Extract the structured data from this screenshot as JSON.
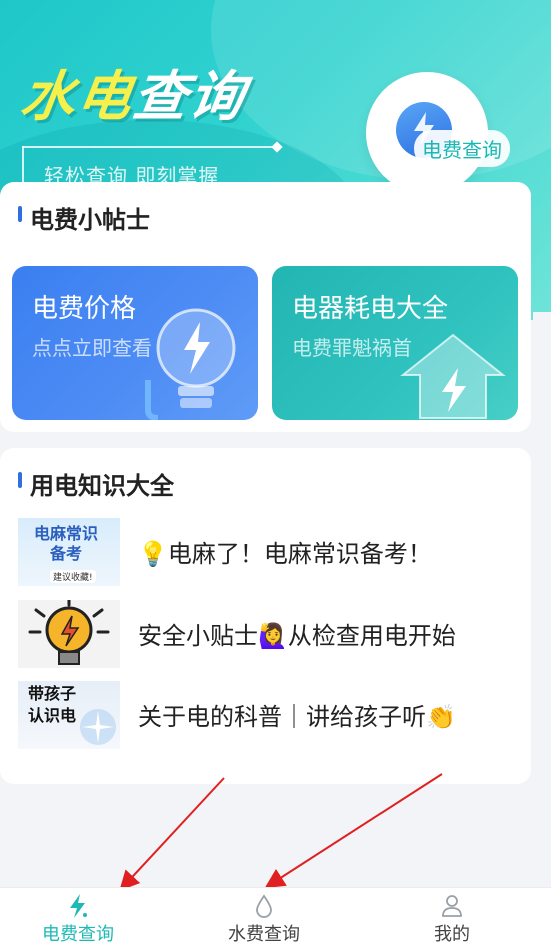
{
  "banner": {
    "title_part1": "水电",
    "title_part2": "查询",
    "slogan": "轻松查询 即刻掌握",
    "badge_label": "电费查询"
  },
  "tips_section": {
    "title": "电费小帖士",
    "tiles": [
      {
        "title": "电费价格",
        "subtitle": "点点立即查看"
      },
      {
        "title": "电器耗电大全",
        "subtitle": "电费罪魁祸首"
      }
    ]
  },
  "knowledge_section": {
    "title": "用电知识大全",
    "articles": [
      {
        "title": "💡电麻了！电麻常识备考！",
        "thumb_text": "电麻常识\n备考",
        "thumb_small": "建议收藏!"
      },
      {
        "title": "安全小贴士🙋‍♀️从检查用电开始",
        "thumb_text": "",
        "thumb_small": ""
      },
      {
        "title": "关于电的科普｜讲给孩子听👏",
        "thumb_text": "带孩子\n认识电",
        "thumb_small": ""
      }
    ]
  },
  "bottom_nav": {
    "items": [
      {
        "label": "电费查询",
        "active": true
      },
      {
        "label": "水费查询",
        "active": false
      },
      {
        "label": "我的",
        "active": false
      }
    ]
  },
  "colors": {
    "accent": "#1fb9b4",
    "banner": "#2dcfcd",
    "annotation_arrow": "#e02020"
  }
}
